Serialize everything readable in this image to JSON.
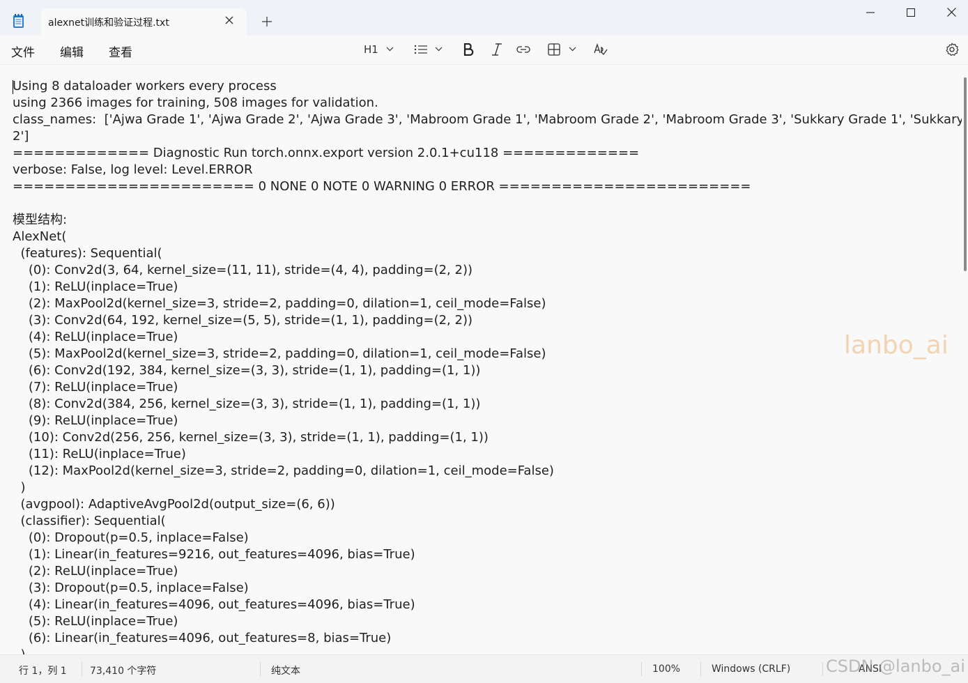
{
  "tab": {
    "title": "alexnet训练和验证过程.txt"
  },
  "menu": {
    "file": "文件",
    "edit": "编辑",
    "view": "查看"
  },
  "toolbar": {
    "heading": "H1",
    "icons": [
      "list-icon",
      "bold-icon",
      "italic-icon",
      "link-icon",
      "table-icon",
      "spellcheck-icon",
      "settings-icon"
    ]
  },
  "content": {
    "lines": [
      "Using 8 dataloader workers every process",
      "using 2366 images for training, 508 images for validation.",
      "class_names:  ['Ajwa Grade 1', 'Ajwa Grade 2', 'Ajwa Grade 3', 'Mabroom Grade 1', 'Mabroom Grade 2', 'Mabroom Grade 3', 'Sukkary Grade 1', 'Sukkary Grade",
      "2']",
      "============= Diagnostic Run torch.onnx.export version 2.0.1+cu118 =============",
      "verbose: False, log level: Level.ERROR",
      "======================= 0 NONE 0 NOTE 0 WARNING 0 ERROR ========================",
      "",
      "模型结构:",
      "AlexNet(",
      "  (features): Sequential(",
      "    (0): Conv2d(3, 64, kernel_size=(11, 11), stride=(4, 4), padding=(2, 2))",
      "    (1): ReLU(inplace=True)",
      "    (2): MaxPool2d(kernel_size=3, stride=2, padding=0, dilation=1, ceil_mode=False)",
      "    (3): Conv2d(64, 192, kernel_size=(5, 5), stride=(1, 1), padding=(2, 2))",
      "    (4): ReLU(inplace=True)",
      "    (5): MaxPool2d(kernel_size=3, stride=2, padding=0, dilation=1, ceil_mode=False)",
      "    (6): Conv2d(192, 384, kernel_size=(3, 3), stride=(1, 1), padding=(1, 1))",
      "    (7): ReLU(inplace=True)",
      "    (8): Conv2d(384, 256, kernel_size=(3, 3), stride=(1, 1), padding=(1, 1))",
      "    (9): ReLU(inplace=True)",
      "    (10): Conv2d(256, 256, kernel_size=(3, 3), stride=(1, 1), padding=(1, 1))",
      "    (11): ReLU(inplace=True)",
      "    (12): MaxPool2d(kernel_size=3, stride=2, padding=0, dilation=1, ceil_mode=False)",
      "  )",
      "  (avgpool): AdaptiveAvgPool2d(output_size=(6, 6))",
      "  (classifier): Sequential(",
      "    (0): Dropout(p=0.5, inplace=False)",
      "    (1): Linear(in_features=9216, out_features=4096, bias=True)",
      "    (2): ReLU(inplace=True)",
      "    (3): Dropout(p=0.5, inplace=False)",
      "    (4): Linear(in_features=4096, out_features=4096, bias=True)",
      "    (5): ReLU(inplace=True)",
      "    (6): Linear(in_features=4096, out_features=8, bias=True)",
      "  )"
    ],
    "watermark": "lanbo_ai"
  },
  "status": {
    "position": "行 1，列 1",
    "char_count": "73,410 个字符",
    "format": "纯文本",
    "zoom": "100%",
    "line_ending": "Windows (CRLF)",
    "encoding": "ANSI",
    "watermark": "CSDN @lanbo_ai"
  },
  "colors": {
    "titlebar_bg": "#eff3f7",
    "editor_bg": "#f9f9f9",
    "watermark": "#f2d3b4"
  }
}
